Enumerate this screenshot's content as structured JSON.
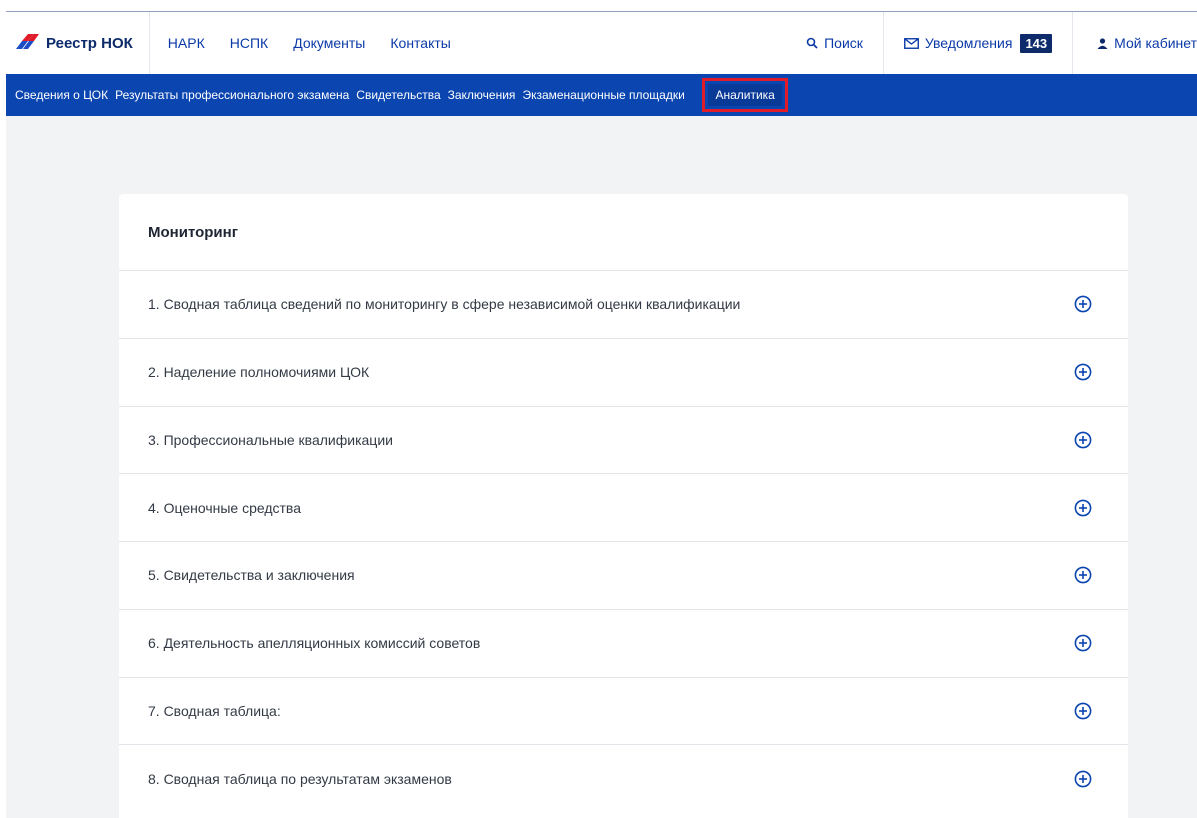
{
  "header": {
    "logo_text": "Реестр НОК",
    "nav": [
      {
        "label": "НАРК"
      },
      {
        "label": "НСПК"
      },
      {
        "label": "Документы"
      },
      {
        "label": "Контакты"
      }
    ],
    "search_label": "Поиск",
    "notifications_label": "Уведомления",
    "notifications_count": "143",
    "cabinet_label": "Мой кабинет"
  },
  "subnav": {
    "items": [
      {
        "label": "Сведения о ЦОК"
      },
      {
        "label": "Результаты профессионального экзамена"
      },
      {
        "label": "Свидетельства"
      },
      {
        "label": "Заключения"
      },
      {
        "label": "Экзаменационные площадки"
      },
      {
        "label": "Аналитика"
      }
    ],
    "active": "Аналитика"
  },
  "monitoring": {
    "title": "Мониторинг",
    "items": [
      {
        "label": "1. Сводная таблица сведений по мониторингу в сфере независимой оценки квалификации"
      },
      {
        "label": "2. Наделение полномочиями ЦОК"
      },
      {
        "label": "3. Профессиональные квалификации"
      },
      {
        "label": "4. Оценочные средства"
      },
      {
        "label": "5. Свидетельства и заключения"
      },
      {
        "label": "6. Деятельность апелляционных комиссий советов"
      },
      {
        "label": "7. Сводная таблица:"
      },
      {
        "label": "8. Сводная таблица по результатам экзаменов"
      }
    ]
  },
  "icons": {
    "logo": "flag-logo-icon",
    "search": "search-icon",
    "notifications": "envelope-icon",
    "cabinet": "user-icon",
    "expand": "plus-circle-icon"
  },
  "colors": {
    "primary": "#0b45b0",
    "link": "#0b3aa8",
    "highlight": "#e11c2a",
    "badge": "#0d2a6b"
  }
}
